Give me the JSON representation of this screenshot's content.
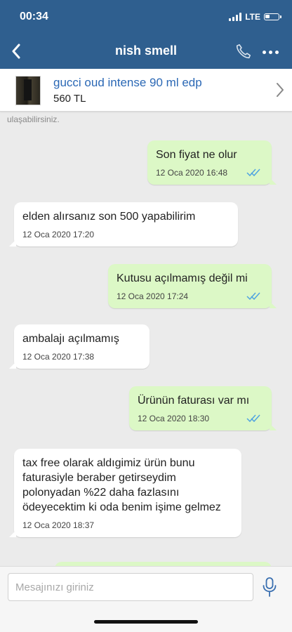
{
  "status_bar": {
    "time": "00:34",
    "network": "LTE",
    "battery_level": 0.35
  },
  "nav": {
    "title": "nish smell"
  },
  "product": {
    "name": "gucci oud intense 90 ml edp",
    "price": "560 TL"
  },
  "chat": {
    "partial_note": "ulaşabilirsiniz.",
    "messages": [
      {
        "direction": "sent",
        "text": "Son fiyat ne olur",
        "time": "12 Oca 2020 16:48",
        "read": true
      },
      {
        "direction": "received",
        "text": "elden alırsanız son 500 yapabilirim",
        "time": "12 Oca 2020 17:20"
      },
      {
        "direction": "sent",
        "text": "Kutusu açılmamış değil mi",
        "time": "12 Oca 2020 17:24",
        "read": true
      },
      {
        "direction": "received",
        "text": "ambalajı açılmamış",
        "time": "12 Oca 2020 17:38"
      },
      {
        "direction": "sent",
        "text": "Ürünün faturası var mı",
        "time": "12 Oca 2020 18:30",
        "read": true
      },
      {
        "direction": "received",
        "text": "tax free olarak aldıgimiz ürün bunu faturasiyle beraber getirseydim polonyadan %22 daha fazlasını ödeyecektim ki oda benim işime gelmez",
        "time": "12 Oca 2020 18:37"
      }
    ]
  },
  "input": {
    "placeholder": "Mesajınızı giriniz"
  },
  "colors": {
    "header": "#2f5f8f",
    "link": "#2b68b5",
    "sent_bubble": "#dcf8c6",
    "received_bubble": "#ffffff",
    "read_ticks": "#4fa3e0",
    "mic": "#3a6fb0"
  },
  "icons": [
    "back-chevron",
    "phone",
    "more-dots",
    "chevron-right",
    "double-check",
    "microphone"
  ]
}
